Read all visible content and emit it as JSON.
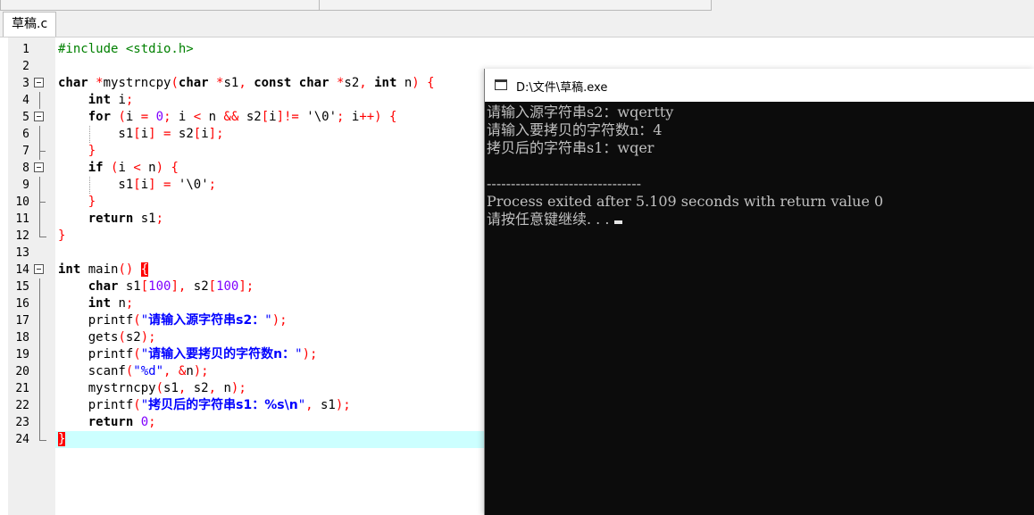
{
  "tabs": [
    {
      "label": "草稿.c"
    }
  ],
  "editor": {
    "current_line": 24,
    "lines": [
      {
        "n": "1",
        "segs": [
          {
            "t": "#include <stdio.h>",
            "c": "pp"
          }
        ]
      },
      {
        "n": "2",
        "segs": []
      },
      {
        "n": "3",
        "segs": [
          {
            "t": "char",
            "c": "kw"
          },
          {
            "t": " ",
            "c": ""
          },
          {
            "t": "*",
            "c": "op"
          },
          {
            "t": "mystrncpy",
            "c": ""
          },
          {
            "t": "(",
            "c": "op"
          },
          {
            "t": "char",
            "c": "kw"
          },
          {
            "t": " ",
            "c": ""
          },
          {
            "t": "*",
            "c": "op"
          },
          {
            "t": "s1",
            "c": ""
          },
          {
            "t": ", ",
            "c": "op"
          },
          {
            "t": "const",
            "c": "kw"
          },
          {
            "t": " ",
            "c": ""
          },
          {
            "t": "char",
            "c": "kw"
          },
          {
            "t": " ",
            "c": ""
          },
          {
            "t": "*",
            "c": "op"
          },
          {
            "t": "s2",
            "c": ""
          },
          {
            "t": ", ",
            "c": "op"
          },
          {
            "t": "int",
            "c": "kw"
          },
          {
            "t": " n",
            "c": ""
          },
          {
            "t": ") {",
            "c": "op"
          }
        ]
      },
      {
        "n": "4",
        "segs": [
          {
            "t": "    ",
            "c": ""
          },
          {
            "t": "int",
            "c": "kw"
          },
          {
            "t": " i",
            "c": ""
          },
          {
            "t": ";",
            "c": "op"
          }
        ]
      },
      {
        "n": "5",
        "segs": [
          {
            "t": "    ",
            "c": ""
          },
          {
            "t": "for",
            "c": "kw"
          },
          {
            "t": " ",
            "c": ""
          },
          {
            "t": "(",
            "c": "op"
          },
          {
            "t": "i ",
            "c": ""
          },
          {
            "t": "=",
            "c": "op"
          },
          {
            "t": " ",
            "c": ""
          },
          {
            "t": "0",
            "c": "num"
          },
          {
            "t": ";",
            "c": "op"
          },
          {
            "t": " i ",
            "c": ""
          },
          {
            "t": "<",
            "c": "op"
          },
          {
            "t": " n ",
            "c": ""
          },
          {
            "t": "&&",
            "c": "op"
          },
          {
            "t": " s2",
            "c": ""
          },
          {
            "t": "[",
            "c": "op"
          },
          {
            "t": "i",
            "c": ""
          },
          {
            "t": "]!=",
            "c": "op"
          },
          {
            "t": " ",
            "c": ""
          },
          {
            "t": "'\\0'",
            "c": "chr"
          },
          {
            "t": ";",
            "c": "op"
          },
          {
            "t": " i",
            "c": ""
          },
          {
            "t": "++) {",
            "c": "op"
          }
        ]
      },
      {
        "n": "6",
        "segs": [
          {
            "t": "        s1",
            "c": ""
          },
          {
            "t": "[",
            "c": "op"
          },
          {
            "t": "i",
            "c": ""
          },
          {
            "t": "]",
            "c": "op"
          },
          {
            "t": " ",
            "c": ""
          },
          {
            "t": "=",
            "c": "op"
          },
          {
            "t": " s2",
            "c": ""
          },
          {
            "t": "[",
            "c": "op"
          },
          {
            "t": "i",
            "c": ""
          },
          {
            "t": "];",
            "c": "op"
          }
        ]
      },
      {
        "n": "7",
        "segs": [
          {
            "t": "    ",
            "c": ""
          },
          {
            "t": "}",
            "c": "op"
          }
        ]
      },
      {
        "n": "8",
        "segs": [
          {
            "t": "    ",
            "c": ""
          },
          {
            "t": "if",
            "c": "kw"
          },
          {
            "t": " ",
            "c": ""
          },
          {
            "t": "(",
            "c": "op"
          },
          {
            "t": "i ",
            "c": ""
          },
          {
            "t": "<",
            "c": "op"
          },
          {
            "t": " n",
            "c": ""
          },
          {
            "t": ") {",
            "c": "op"
          }
        ]
      },
      {
        "n": "9",
        "segs": [
          {
            "t": "        s1",
            "c": ""
          },
          {
            "t": "[",
            "c": "op"
          },
          {
            "t": "i",
            "c": ""
          },
          {
            "t": "]",
            "c": "op"
          },
          {
            "t": " ",
            "c": ""
          },
          {
            "t": "=",
            "c": "op"
          },
          {
            "t": " ",
            "c": ""
          },
          {
            "t": "'\\0'",
            "c": "chr"
          },
          {
            "t": ";",
            "c": "op"
          }
        ]
      },
      {
        "n": "10",
        "segs": [
          {
            "t": "    ",
            "c": ""
          },
          {
            "t": "}",
            "c": "op"
          }
        ]
      },
      {
        "n": "11",
        "segs": [
          {
            "t": "    ",
            "c": ""
          },
          {
            "t": "return",
            "c": "kw"
          },
          {
            "t": " s1",
            "c": ""
          },
          {
            "t": ";",
            "c": "op"
          }
        ]
      },
      {
        "n": "12",
        "segs": [
          {
            "t": "}",
            "c": "op"
          }
        ]
      },
      {
        "n": "13",
        "segs": []
      },
      {
        "n": "14",
        "segs": [
          {
            "t": "int",
            "c": "kw"
          },
          {
            "t": " main",
            "c": ""
          },
          {
            "t": "()",
            "c": "op"
          },
          {
            "t": " ",
            "c": ""
          },
          {
            "t": "{",
            "c": "brace-hl"
          }
        ]
      },
      {
        "n": "15",
        "segs": [
          {
            "t": "    ",
            "c": ""
          },
          {
            "t": "char",
            "c": "kw"
          },
          {
            "t": " s1",
            "c": ""
          },
          {
            "t": "[",
            "c": "op"
          },
          {
            "t": "100",
            "c": "num"
          },
          {
            "t": "], ",
            "c": "op"
          },
          {
            "t": "s2",
            "c": ""
          },
          {
            "t": "[",
            "c": "op"
          },
          {
            "t": "100",
            "c": "num"
          },
          {
            "t": "];",
            "c": "op"
          }
        ]
      },
      {
        "n": "16",
        "segs": [
          {
            "t": "    ",
            "c": ""
          },
          {
            "t": "int",
            "c": "kw"
          },
          {
            "t": " n",
            "c": ""
          },
          {
            "t": ";",
            "c": "op"
          }
        ]
      },
      {
        "n": "17",
        "segs": [
          {
            "t": "    printf",
            "c": ""
          },
          {
            "t": "(",
            "c": "op"
          },
          {
            "t": "\"",
            "c": "str"
          },
          {
            "t": "请输入源字符串s2：",
            "c": "strz"
          },
          {
            "t": "\"",
            "c": "str"
          },
          {
            "t": ");",
            "c": "op"
          }
        ]
      },
      {
        "n": "18",
        "segs": [
          {
            "t": "    gets",
            "c": ""
          },
          {
            "t": "(",
            "c": "op"
          },
          {
            "t": "s2",
            "c": ""
          },
          {
            "t": ");",
            "c": "op"
          }
        ]
      },
      {
        "n": "19",
        "segs": [
          {
            "t": "    printf",
            "c": ""
          },
          {
            "t": "(",
            "c": "op"
          },
          {
            "t": "\"",
            "c": "str"
          },
          {
            "t": "请输入要拷贝的字符数n：",
            "c": "strz"
          },
          {
            "t": "\"",
            "c": "str"
          },
          {
            "t": ");",
            "c": "op"
          }
        ]
      },
      {
        "n": "20",
        "segs": [
          {
            "t": "    scanf",
            "c": ""
          },
          {
            "t": "(",
            "c": "op"
          },
          {
            "t": "\"%d\"",
            "c": "str"
          },
          {
            "t": ", ",
            "c": "op"
          },
          {
            "t": "&",
            "c": "op"
          },
          {
            "t": "n",
            "c": ""
          },
          {
            "t": ");",
            "c": "op"
          }
        ]
      },
      {
        "n": "21",
        "segs": [
          {
            "t": "    mystrncpy",
            "c": ""
          },
          {
            "t": "(",
            "c": "op"
          },
          {
            "t": "s1",
            "c": ""
          },
          {
            "t": ", ",
            "c": "op"
          },
          {
            "t": "s2",
            "c": ""
          },
          {
            "t": ", ",
            "c": "op"
          },
          {
            "t": "n",
            "c": ""
          },
          {
            "t": ");",
            "c": "op"
          }
        ]
      },
      {
        "n": "22",
        "segs": [
          {
            "t": "    printf",
            "c": ""
          },
          {
            "t": "(",
            "c": "op"
          },
          {
            "t": "\"",
            "c": "str"
          },
          {
            "t": "拷贝后的字符串s1：%s\\n",
            "c": "strz"
          },
          {
            "t": "\"",
            "c": "str"
          },
          {
            "t": ", ",
            "c": "op"
          },
          {
            "t": "s1",
            "c": ""
          },
          {
            "t": ");",
            "c": "op"
          }
        ]
      },
      {
        "n": "23",
        "segs": [
          {
            "t": "    ",
            "c": ""
          },
          {
            "t": "return",
            "c": "kw"
          },
          {
            "t": " ",
            "c": ""
          },
          {
            "t": "0",
            "c": "num"
          },
          {
            "t": ";",
            "c": "op"
          }
        ]
      },
      {
        "n": "24",
        "segs": [
          {
            "t": "}",
            "c": "brace-hl"
          }
        ]
      }
    ]
  },
  "console": {
    "title": "D:\\文件\\草稿.exe",
    "output_lines": [
      "请输入源字符串s2：wqertty",
      "请输入要拷贝的字符数n：4",
      "拷贝后的字符串s1：wqer",
      "",
      "--------------------------------",
      "Process exited after 5.109 seconds with return value 0",
      "请按任意键继续. . ."
    ]
  }
}
